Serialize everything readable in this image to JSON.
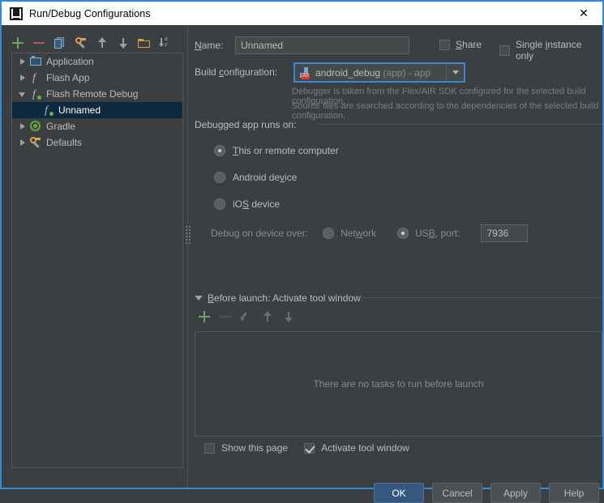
{
  "window": {
    "title": "Run/Debug Configurations",
    "icon": "intellij-idea-logo",
    "close_label": "✕"
  },
  "left_panel": {
    "toolbar": [
      {
        "name": "add-configuration",
        "icon": "plus-icon",
        "color": "#6ca860"
      },
      {
        "name": "remove-configuration",
        "icon": "minus-icon",
        "color": "#c75450"
      },
      {
        "name": "copy-configuration",
        "icon": "copy-icon",
        "color": "#6f9fc4"
      },
      {
        "name": "edit-templates",
        "icon": "wrench-icon",
        "color": "#d9a343"
      },
      {
        "name": "move-up",
        "icon": "arrow-up-icon",
        "color": "#9aa0a6"
      },
      {
        "name": "move-down",
        "icon": "arrow-down-icon",
        "color": "#9aa0a6"
      },
      {
        "name": "create-folder",
        "icon": "folder-icon",
        "color": "#d9a343"
      },
      {
        "name": "sort-configurations",
        "icon": "sort-alphabetical-icon",
        "color": "#9aa0a6"
      }
    ],
    "tree": [
      {
        "label": "Application",
        "icon": "application-icon",
        "expanded": false,
        "indent": 0,
        "selected": false
      },
      {
        "label": "Flash App",
        "icon": "flash-icon",
        "expanded": false,
        "indent": 0,
        "selected": false
      },
      {
        "label": "Flash Remote Debug",
        "icon": "flash-debug-icon",
        "expanded": true,
        "indent": 0,
        "selected": false
      },
      {
        "label": "Unnamed",
        "icon": "flash-debug-icon",
        "expanded": null,
        "indent": 1,
        "selected": true
      },
      {
        "label": "Gradle",
        "icon": "gradle-icon",
        "expanded": false,
        "indent": 0,
        "selected": false
      },
      {
        "label": "Defaults",
        "icon": "wrench-icon",
        "expanded": false,
        "indent": 0,
        "selected": false
      }
    ]
  },
  "right_panel": {
    "name_label": "Name:",
    "name_value": "Unnamed",
    "share": {
      "label": "Share",
      "checked": false
    },
    "single_instance": {
      "label": "Single instance only",
      "checked": false
    },
    "build_configuration_label": "Build configuration:",
    "build_configuration_value": "android_debug",
    "build_configuration_suffix": "(app) - app",
    "build_configuration_icon": "android-studio-module-icon",
    "hint_1": "Debugger is taken from the Flex/AIR SDK configured for the selected build configuration.",
    "hint_2": "Source files are searched according to the dependencies of the selected build configuration.",
    "debugged_group_title": "Debugged app runs on:",
    "radios": [
      {
        "label": "This or remote computer",
        "selected": true
      },
      {
        "label": "Android device",
        "selected": false
      },
      {
        "label": "iOS device",
        "selected": false
      }
    ],
    "debug_over_label": "Debug on device over:",
    "debug_over_options": [
      {
        "label": "Network",
        "selected": false
      },
      {
        "label": "USB, port:",
        "selected": true
      }
    ],
    "port_value": "7936",
    "before_launch_title": "Before launch: Activate tool window",
    "before_launch_toolbar": [
      {
        "name": "add-task",
        "icon": "plus-icon",
        "enabled": true
      },
      {
        "name": "remove-task",
        "icon": "minus-icon",
        "enabled": false
      },
      {
        "name": "edit-task",
        "icon": "pencil-icon",
        "enabled": false
      },
      {
        "name": "move-task-up",
        "icon": "arrow-up-icon",
        "enabled": false
      },
      {
        "name": "move-task-down",
        "icon": "arrow-down-icon",
        "enabled": false
      }
    ],
    "before_launch_empty": "There are no tasks to run before launch",
    "show_this_page": {
      "label": "Show this page",
      "checked": false
    },
    "activate_tool_window": {
      "label": "Activate tool window",
      "checked": true
    }
  },
  "buttons": {
    "ok": "OK",
    "cancel": "Cancel",
    "apply": "Apply",
    "help": "Help"
  },
  "colors": {
    "window_background": "#3c3f41",
    "accent_border": "#2d8cdb",
    "selection": "#0d293e",
    "primary_button": "#365880",
    "focus_ring": "#3b88d0",
    "text": "#bbbbbb",
    "muted_text": "#8a8a8a"
  }
}
